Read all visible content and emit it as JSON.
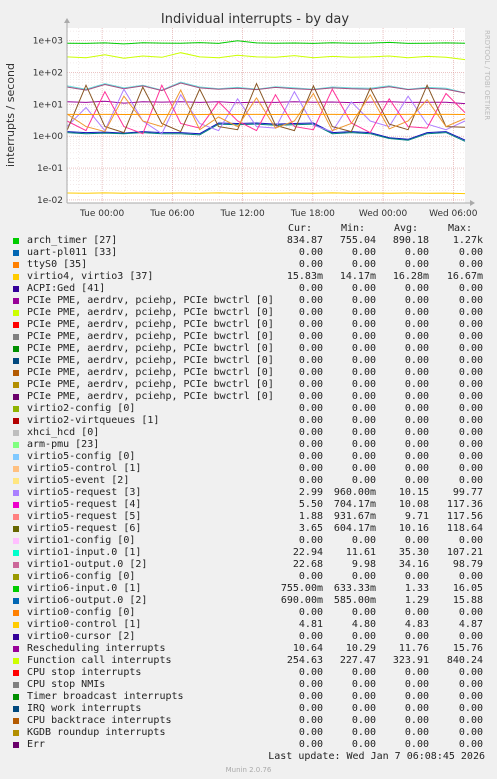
{
  "chart_data": {
    "type": "line",
    "title": "Individual interrupts - by day",
    "ylabel": "interrupts / second",
    "side_label": "RRDTOOL / TOBI OETIKER",
    "y_scale": "log",
    "ylim": [
      0.008,
      2500
    ],
    "y_ticks": [
      {
        "v": 0.01,
        "label": "1e-02"
      },
      {
        "v": 0.1,
        "label": "1e-01"
      },
      {
        "v": 1,
        "label": "1e+00"
      },
      {
        "v": 10,
        "label": "1e+01"
      },
      {
        "v": 100,
        "label": "1e+02"
      },
      {
        "v": 1000,
        "label": "1e+03"
      }
    ],
    "x_ticks": [
      {
        "h": 0,
        "label": "Tue 00:00"
      },
      {
        "h": 6,
        "label": "Tue 06:00"
      },
      {
        "h": 12,
        "label": "Tue 12:00"
      },
      {
        "h": 18,
        "label": "Tue 18:00"
      },
      {
        "h": 24,
        "label": "Wed 00:00"
      },
      {
        "h": 30,
        "label": "Wed 06:00"
      }
    ],
    "xlim_hours": [
      -3,
      31
    ],
    "grid": true,
    "series": [
      {
        "name": "arch_timer [27]",
        "color": "#00cc00",
        "values": [
          835,
          820,
          850,
          790,
          860,
          840,
          830,
          870,
          820,
          990,
          850,
          830,
          845,
          820,
          860,
          830,
          840,
          880,
          820,
          830,
          850,
          835
        ]
      },
      {
        "name": "virtio4, virtio3 [37]",
        "color": "#ffcc00",
        "values": [
          0.0165,
          0.0162,
          0.0166,
          0.0163,
          0.0164,
          0.0162,
          0.0165,
          0.0163,
          0.0166,
          0.0162,
          0.0164,
          0.0163,
          0.0165,
          0.0162,
          0.0166,
          0.0163,
          0.0164,
          0.0162,
          0.0165,
          0.0163,
          0.0164,
          0.0158
        ]
      },
      {
        "name": "Function call interrupts",
        "color": "#ccff00",
        "values": [
          310,
          290,
          360,
          280,
          330,
          300,
          420,
          310,
          290,
          350,
          310,
          300,
          340,
          290,
          320,
          300,
          310,
          330,
          290,
          320,
          300,
          255
        ]
      },
      {
        "name": "virtio6-input.0 [1]",
        "color": "#1414bb",
        "values": [
          1.4,
          1.3,
          1.35,
          1.25,
          1.4,
          1.3,
          1.3,
          1.2,
          2.6,
          2.5,
          2.6,
          2.4,
          2.5,
          2.6,
          1.3,
          1.4,
          1.3,
          0.9,
          0.8,
          1.3,
          1.4,
          0.755
        ]
      },
      {
        "name": "virtio6-output.0 [2]",
        "color": "#008080",
        "values": [
          1.3,
          1.2,
          1.25,
          1.2,
          1.3,
          1.2,
          1.2,
          1.1,
          2.4,
          2.3,
          2.4,
          2.2,
          2.3,
          2.4,
          1.2,
          1.3,
          1.2,
          0.85,
          0.75,
          1.2,
          1.3,
          0.69
        ]
      },
      {
        "name": "virtio1-input.0 [1]",
        "color": "#66dddd",
        "values": [
          38,
          30,
          45,
          33,
          40,
          28,
          50,
          35,
          31,
          34,
          30,
          36,
          33,
          30,
          35,
          33,
          32,
          38,
          30,
          34,
          32,
          23
        ]
      },
      {
        "name": "virtio1-output.0 [2]",
        "color": "#a05080",
        "values": [
          35,
          28,
          42,
          31,
          38,
          27,
          47,
          33,
          30,
          32,
          29,
          34,
          31,
          29,
          33,
          31,
          30,
          36,
          29,
          32,
          30,
          22.7
        ]
      },
      {
        "name": "Rescheduling interrupts",
        "color": "#990099",
        "values": [
          12,
          11.5,
          12.5,
          11,
          12,
          11.8,
          12,
          11.5,
          12,
          11.2,
          11.8,
          11.5,
          12,
          11.6,
          11.9,
          11.4,
          11.8,
          12,
          11.5,
          11.7,
          11.6,
          10.6
        ]
      },
      {
        "name": "virtio5-request [3]",
        "color": "#b080ff",
        "values": [
          2,
          8,
          1.5,
          30,
          3,
          1.2,
          20,
          2.5,
          1.5,
          15,
          2,
          1.8,
          25,
          2.2,
          1.4,
          12,
          3,
          2,
          18,
          2.4,
          1.6,
          3
        ]
      },
      {
        "name": "virtio5-request [4]",
        "color": "#ff3399",
        "values": [
          3,
          1.5,
          25,
          2,
          1.2,
          40,
          2.5,
          1.8,
          12,
          3,
          1.5,
          20,
          2,
          1.6,
          30,
          2.6,
          1.3,
          15,
          2,
          1.8,
          22,
          5.5
        ]
      },
      {
        "name": "virtio5-request [5]",
        "color": "#885522",
        "values": [
          1.5,
          40,
          2,
          1.3,
          35,
          2.5,
          1.4,
          30,
          2,
          1.6,
          45,
          2.2,
          1.5,
          38,
          2,
          1.4,
          32,
          2.4,
          1.6,
          40,
          2,
          1.9
        ]
      },
      {
        "name": "virtio5-request [6]",
        "color": "#ee9933",
        "values": [
          5,
          2,
          1.4,
          18,
          3,
          2,
          28,
          1.6,
          4,
          2,
          16,
          1.8,
          3,
          22,
          1.5,
          2.5,
          20,
          1.7,
          3,
          14,
          2,
          3.6
        ]
      },
      {
        "name": "virtio0-control [1]",
        "color": "#ff9900",
        "values": [
          4.83,
          4.8,
          4.85,
          4.82,
          4.84,
          4.8,
          4.83,
          4.82,
          4.85,
          4.81,
          4.83,
          4.82,
          4.84,
          4.8,
          4.83,
          4.82,
          4.85,
          4.81,
          4.83,
          4.82,
          4.84,
          4.81
        ]
      }
    ]
  },
  "legend": {
    "headers": {
      "cur": "Cur:",
      "min": "Min:",
      "avg": "Avg:",
      "max": "Max:"
    },
    "rows": [
      {
        "name": "arch_timer [27]",
        "color": "#00cc00",
        "cur": "834.87",
        "min": "755.04",
        "avg": "890.18",
        "max": "1.27k"
      },
      {
        "name": "uart-pl011 [33]",
        "color": "#0066b3",
        "cur": "0.00",
        "min": "0.00",
        "avg": "0.00",
        "max": "0.00"
      },
      {
        "name": "ttyS0 [35]",
        "color": "#ff8000",
        "cur": "0.00",
        "min": "0.00",
        "avg": "0.00",
        "max": "0.00"
      },
      {
        "name": "virtio4, virtio3 [37]",
        "color": "#ffcc00",
        "cur": "15.83m",
        "min": "14.17m",
        "avg": "16.28m",
        "max": "16.67m"
      },
      {
        "name": "ACPI:Ged [41]",
        "color": "#330099",
        "cur": "0.00",
        "min": "0.00",
        "avg": "0.00",
        "max": "0.00"
      },
      {
        "name": "PCIe PME, aerdrv, pciehp, PCIe bwctrl [0]",
        "color": "#990099",
        "cur": "0.00",
        "min": "0.00",
        "avg": "0.00",
        "max": "0.00"
      },
      {
        "name": "PCIe PME, aerdrv, pciehp, PCIe bwctrl [0]",
        "color": "#ccff00",
        "cur": "0.00",
        "min": "0.00",
        "avg": "0.00",
        "max": "0.00"
      },
      {
        "name": "PCIe PME, aerdrv, pciehp, PCIe bwctrl [0]",
        "color": "#ff0000",
        "cur": "0.00",
        "min": "0.00",
        "avg": "0.00",
        "max": "0.00"
      },
      {
        "name": "PCIe PME, aerdrv, pciehp, PCIe bwctrl [0]",
        "color": "#808080",
        "cur": "0.00",
        "min": "0.00",
        "avg": "0.00",
        "max": "0.00"
      },
      {
        "name": "PCIe PME, aerdrv, pciehp, PCIe bwctrl [0]",
        "color": "#008f00",
        "cur": "0.00",
        "min": "0.00",
        "avg": "0.00",
        "max": "0.00"
      },
      {
        "name": "PCIe PME, aerdrv, pciehp, PCIe bwctrl [0]",
        "color": "#00487d",
        "cur": "0.00",
        "min": "0.00",
        "avg": "0.00",
        "max": "0.00"
      },
      {
        "name": "PCIe PME, aerdrv, pciehp, PCIe bwctrl [0]",
        "color": "#b35a00",
        "cur": "0.00",
        "min": "0.00",
        "avg": "0.00",
        "max": "0.00"
      },
      {
        "name": "PCIe PME, aerdrv, pciehp, PCIe bwctrl [0]",
        "color": "#b38f00",
        "cur": "0.00",
        "min": "0.00",
        "avg": "0.00",
        "max": "0.00"
      },
      {
        "name": "PCIe PME, aerdrv, pciehp, PCIe bwctrl [0]",
        "color": "#6b006b",
        "cur": "0.00",
        "min": "0.00",
        "avg": "0.00",
        "max": "0.00"
      },
      {
        "name": "virtio2-config [0]",
        "color": "#8fb300",
        "cur": "0.00",
        "min": "0.00",
        "avg": "0.00",
        "max": "0.00"
      },
      {
        "name": "virtio2-virtqueues [1]",
        "color": "#b30000",
        "cur": "0.00",
        "min": "0.00",
        "avg": "0.00",
        "max": "0.00"
      },
      {
        "name": "xhci_hcd [0]",
        "color": "#bebebe",
        "cur": "0.00",
        "min": "0.00",
        "avg": "0.00",
        "max": "0.00"
      },
      {
        "name": "arm-pmu [23]",
        "color": "#80ff80",
        "cur": "0.00",
        "min": "0.00",
        "avg": "0.00",
        "max": "0.00"
      },
      {
        "name": "virtio5-config [0]",
        "color": "#80c9ff",
        "cur": "0.00",
        "min": "0.00",
        "avg": "0.00",
        "max": "0.00"
      },
      {
        "name": "virtio5-control [1]",
        "color": "#ffc080",
        "cur": "0.00",
        "min": "0.00",
        "avg": "0.00",
        "max": "0.00"
      },
      {
        "name": "virtio5-event [2]",
        "color": "#ffe680",
        "cur": "0.00",
        "min": "0.00",
        "avg": "0.00",
        "max": "0.00"
      },
      {
        "name": "virtio5-request [3]",
        "color": "#aa80ff",
        "cur": "2.99",
        "min": "960.00m",
        "avg": "10.15",
        "max": "99.77"
      },
      {
        "name": "virtio5-request [4]",
        "color": "#ee00cc",
        "cur": "5.50",
        "min": "704.17m",
        "avg": "10.08",
        "max": "117.36"
      },
      {
        "name": "virtio5-request [5]",
        "color": "#ff8080",
        "cur": "1.88",
        "min": "931.67m",
        "avg": "9.71",
        "max": "117.56"
      },
      {
        "name": "virtio5-request [6]",
        "color": "#666600",
        "cur": "3.65",
        "min": "604.17m",
        "avg": "10.16",
        "max": "118.64"
      },
      {
        "name": "virtio1-config [0]",
        "color": "#ffbfff",
        "cur": "0.00",
        "min": "0.00",
        "avg": "0.00",
        "max": "0.00"
      },
      {
        "name": "virtio1-input.0 [1]",
        "color": "#00ffcc",
        "cur": "22.94",
        "min": "11.61",
        "avg": "35.30",
        "max": "107.21"
      },
      {
        "name": "virtio1-output.0 [2]",
        "color": "#cc6699",
        "cur": "22.68",
        "min": "9.98",
        "avg": "34.16",
        "max": "98.79"
      },
      {
        "name": "virtio6-config [0]",
        "color": "#999900",
        "cur": "0.00",
        "min": "0.00",
        "avg": "0.00",
        "max": "0.00"
      },
      {
        "name": "virtio6-input.0 [1]",
        "color": "#00cc00",
        "cur": "755.00m",
        "min": "633.33m",
        "avg": "1.33",
        "max": "16.05"
      },
      {
        "name": "virtio6-output.0 [2]",
        "color": "#0066b3",
        "cur": "690.00m",
        "min": "585.00m",
        "avg": "1.29",
        "max": "15.88"
      },
      {
        "name": "virtio0-config [0]",
        "color": "#ff8000",
        "cur": "0.00",
        "min": "0.00",
        "avg": "0.00",
        "max": "0.00"
      },
      {
        "name": "virtio0-control [1]",
        "color": "#ffcc00",
        "cur": "4.81",
        "min": "4.80",
        "avg": "4.83",
        "max": "4.87"
      },
      {
        "name": "virtio0-cursor [2]",
        "color": "#330099",
        "cur": "0.00",
        "min": "0.00",
        "avg": "0.00",
        "max": "0.00"
      },
      {
        "name": "Rescheduling interrupts",
        "color": "#990099",
        "cur": "10.64",
        "min": "10.29",
        "avg": "11.76",
        "max": "15.76"
      },
      {
        "name": "Function call interrupts",
        "color": "#ccff00",
        "cur": "254.63",
        "min": "227.47",
        "avg": "323.91",
        "max": "840.24"
      },
      {
        "name": "CPU stop interrupts",
        "color": "#ff0000",
        "cur": "0.00",
        "min": "0.00",
        "avg": "0.00",
        "max": "0.00"
      },
      {
        "name": "CPU stop NMIs",
        "color": "#808080",
        "cur": "0.00",
        "min": "0.00",
        "avg": "0.00",
        "max": "0.00"
      },
      {
        "name": "Timer broadcast interrupts",
        "color": "#008f00",
        "cur": "0.00",
        "min": "0.00",
        "avg": "0.00",
        "max": "0.00"
      },
      {
        "name": "IRQ work interrupts",
        "color": "#00487d",
        "cur": "0.00",
        "min": "0.00",
        "avg": "0.00",
        "max": "0.00"
      },
      {
        "name": "CPU backtrace interrupts",
        "color": "#b35a00",
        "cur": "0.00",
        "min": "0.00",
        "avg": "0.00",
        "max": "0.00"
      },
      {
        "name": "KGDB roundup interrupts",
        "color": "#b38f00",
        "cur": "0.00",
        "min": "0.00",
        "avg": "0.00",
        "max": "0.00"
      },
      {
        "name": "Err",
        "color": "#6b006b",
        "cur": "0.00",
        "min": "0.00",
        "avg": "0.00",
        "max": "0.00"
      }
    ]
  },
  "last_update": "Last update: Wed Jan  7 06:08:45 2026",
  "footer": "Munin 2.0.76"
}
